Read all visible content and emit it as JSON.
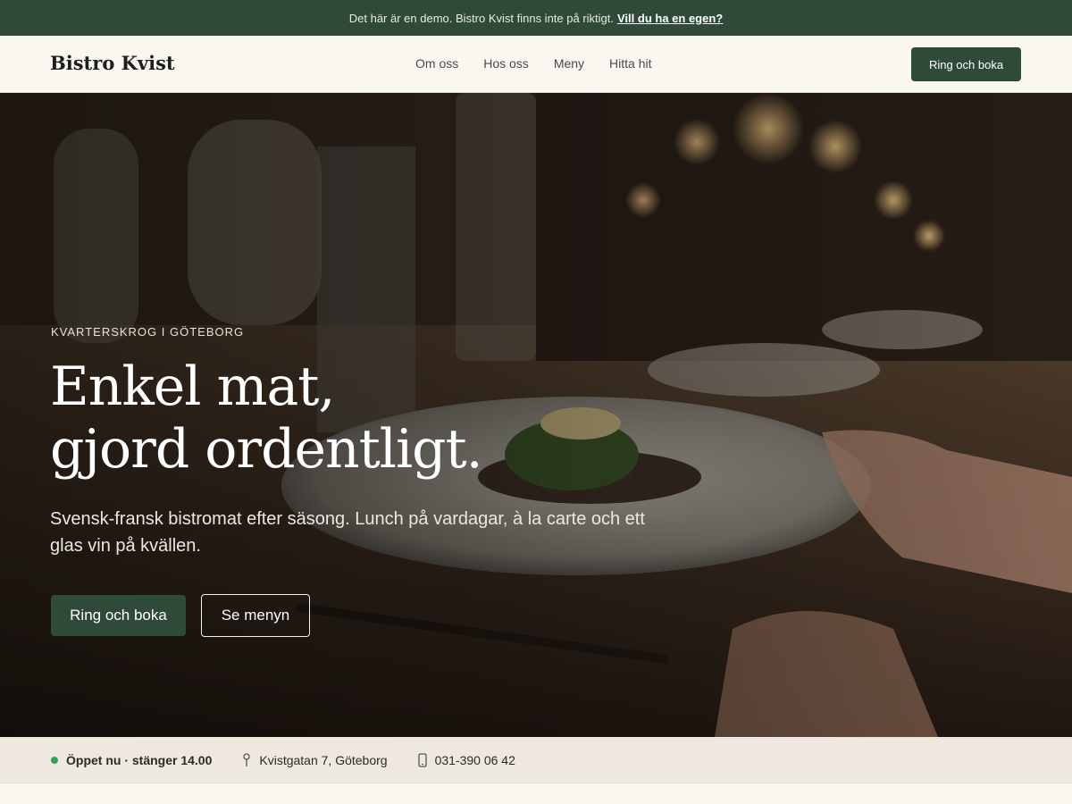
{
  "demo_bar": {
    "text": "Det här är en demo. Bistro Kvist finns inte på riktigt.",
    "link": "Vill du ha en egen?"
  },
  "nav": {
    "brand": "Bistro Kvist",
    "links": [
      "Om oss",
      "Hos oss",
      "Meny",
      "Hitta hit"
    ],
    "cta": "Ring och boka"
  },
  "hero": {
    "eyebrow": "KVARTERSKROG I GÖTEBORG",
    "headline": [
      "Enkel mat,",
      "gjord ordentligt."
    ],
    "lede": "Svensk-fransk bistromat efter säsong. Lunch på vardagar, à la carte och ett glas vin på kvällen.",
    "primary_button": "Ring och boka",
    "secondary_button": "Se menyn"
  },
  "info": {
    "status": "Öppet nu · stänger 14.00",
    "address": "Kvistgatan 7, Göteborg",
    "phone": "031-390 06 42"
  },
  "colors": {
    "brand_green": "#2f4a38",
    "background": "#faf7f0",
    "status_green": "#2fa35a"
  }
}
